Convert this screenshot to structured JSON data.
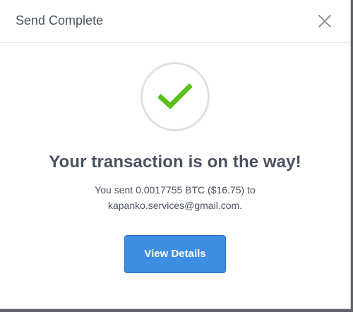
{
  "modal": {
    "title": "Send Complete",
    "close_icon": "close-icon"
  },
  "status": {
    "icon": "checkmark-icon",
    "icon_color": "#5bbf1c",
    "headline": "Your transaction is on the way!",
    "message_line1": "You sent 0.0017755 BTC ($16.75) to",
    "message_line2": "kapanko.services@gmail.com."
  },
  "actions": {
    "view_details_label": "View Details",
    "accent_color": "#3d8de2"
  }
}
